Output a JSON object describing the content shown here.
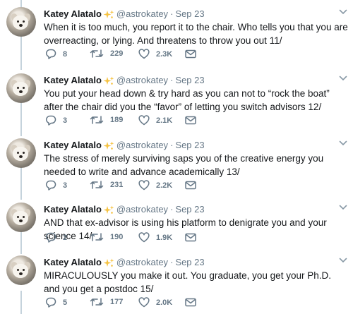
{
  "author": {
    "name": "Katey Alatalo",
    "handle": "@astrokatey",
    "separator": "·"
  },
  "icons": {
    "reply": "reply-bubble-icon",
    "retweet": "retweet-icon",
    "like": "heart-icon",
    "dm": "envelope-icon",
    "caret": "chevron-down-icon",
    "badge": "sparkle-emoji-icon"
  },
  "colors": {
    "text": "#14171a",
    "muted": "#657786",
    "thread_line": "#c5d3dc",
    "sparkle": "#f6c343"
  },
  "tweets": [
    {
      "date": "Sep 23",
      "text": "When it is too much, you report it to the chair. Who tells you that you are overreacting, or lying. And threatens to throw you out 11/",
      "replies": "8",
      "retweets": "229",
      "likes": "2.3K"
    },
    {
      "date": "Sep 23",
      "text": "You put your head down & try hard as you can not to “rock the boat” after the chair did you the “favor” of letting you switch advisors 12/",
      "replies": "3",
      "retweets": "189",
      "likes": "2.1K"
    },
    {
      "date": "Sep 23",
      "text": "The stress of merely surviving saps you of the creative energy you needed to write and advance academically 13/",
      "replies": "3",
      "retweets": "231",
      "likes": "2.2K"
    },
    {
      "date": "Sep 23",
      "text": "AND that ex-advisor is using his platform to denigrate you and your science 14/",
      "replies": "2",
      "retweets": "190",
      "likes": "1.9K"
    },
    {
      "date": "Sep 23",
      "text": "MIRACULOUSLY you make it out. You graduate, you get your Ph.D. and you get a postdoc 15/",
      "replies": "5",
      "retweets": "177",
      "likes": "2.0K"
    }
  ]
}
